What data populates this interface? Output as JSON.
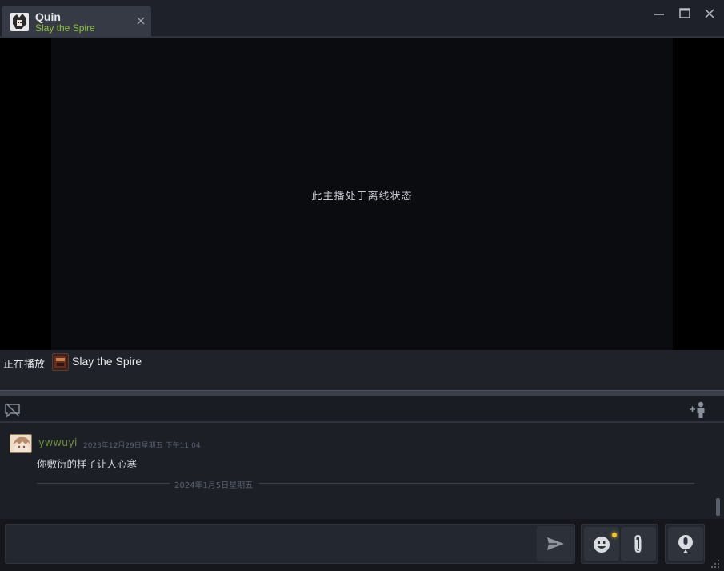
{
  "window": {
    "tab": {
      "name": "Quin",
      "game": "Slay the Spire"
    }
  },
  "video": {
    "offline_message": "此主播处于离线状态"
  },
  "now_playing": {
    "label": "正在播放",
    "game": "Slay the Spire"
  },
  "chat": {
    "messages": [
      {
        "author": "ywwuyi",
        "timestamp": "2023年12月29日星期五 下午11:04",
        "text": "你敷衍的样子让人心寒"
      }
    ],
    "date_separator": "2024年1月5日星期五"
  },
  "input": {
    "value": "",
    "placeholder": ""
  },
  "icons": {
    "tab_close": "close-icon",
    "minimize": "minimize-icon",
    "maximize": "maximize-icon",
    "close": "close-icon",
    "hide_chat": "chat-toggle-icon",
    "add_viewer": "add-person-icon",
    "send": "send-icon",
    "emoji": "emoji-icon",
    "attach": "paperclip-icon",
    "voice": "microphone-icon",
    "resize": "resize-grip-icon"
  },
  "colors": {
    "game_green": "#8fc13c",
    "author_green": "#6e8a3d",
    "notification": "#f2c230"
  }
}
